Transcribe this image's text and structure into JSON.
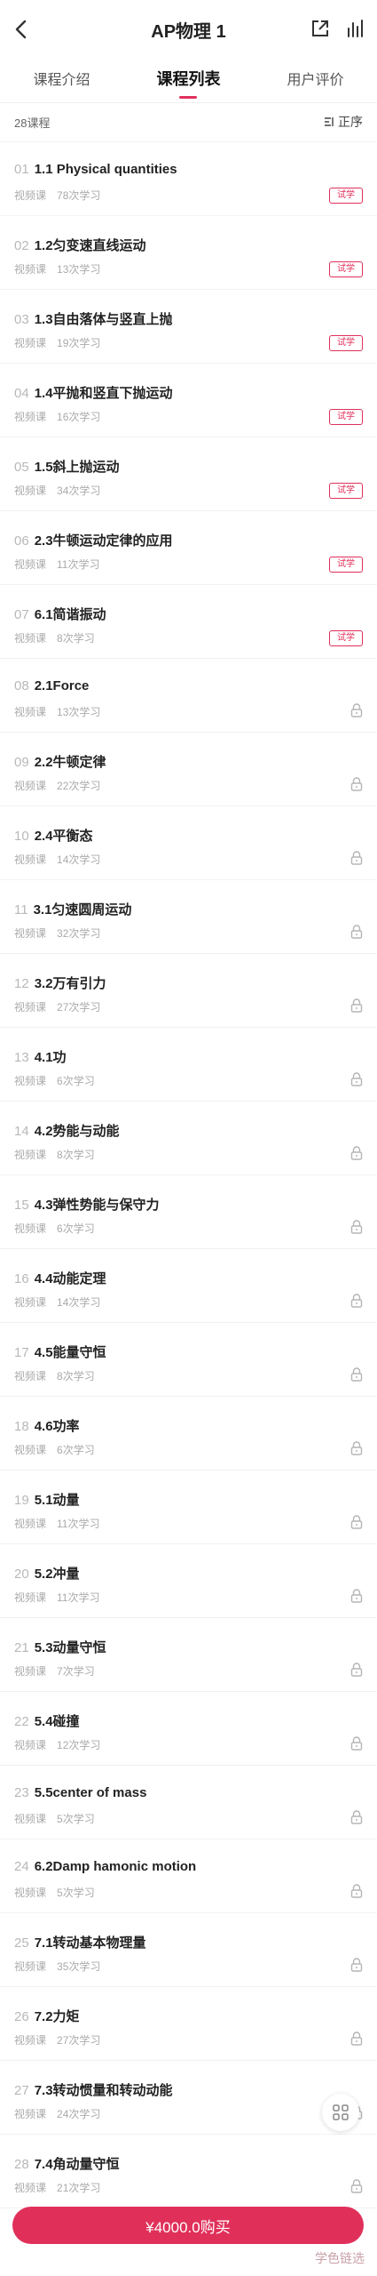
{
  "nav": {
    "title": "AP物理 1"
  },
  "tabs": [
    {
      "label": "课程介绍"
    },
    {
      "label": "课程列表"
    },
    {
      "label": "用户评价"
    }
  ],
  "list_head": {
    "count": "28课程",
    "sort": "正序"
  },
  "items": [
    {
      "num": "01",
      "title": "1.1 Physical quantities",
      "type": "视频课",
      "views": "78次学习",
      "badge": "试学"
    },
    {
      "num": "02",
      "title": "1.2匀变速直线运动",
      "type": "视频课",
      "views": "13次学习",
      "badge": "试学"
    },
    {
      "num": "03",
      "title": "1.3自由落体与竖直上抛",
      "type": "视频课",
      "views": "19次学习",
      "badge": "试学"
    },
    {
      "num": "04",
      "title": "1.4平抛和竖直下抛运动",
      "type": "视频课",
      "views": "16次学习",
      "badge": "试学"
    },
    {
      "num": "05",
      "title": "1.5斜上抛运动",
      "type": "视频课",
      "views": "34次学习",
      "badge": "试学"
    },
    {
      "num": "06",
      "title": "2.3牛顿运动定律的应用",
      "type": "视频课",
      "views": "11次学习",
      "badge": "试学"
    },
    {
      "num": "07",
      "title": "6.1简谐振动",
      "type": "视频课",
      "views": "8次学习",
      "badge": "试学"
    },
    {
      "num": "08",
      "title": "2.1Force",
      "type": "视频课",
      "views": "13次学习",
      "badge": ""
    },
    {
      "num": "09",
      "title": "2.2牛顿定律",
      "type": "视频课",
      "views": "22次学习",
      "badge": ""
    },
    {
      "num": "10",
      "title": "2.4平衡态",
      "type": "视频课",
      "views": "14次学习",
      "badge": ""
    },
    {
      "num": "11",
      "title": "3.1匀速圆周运动",
      "type": "视频课",
      "views": "32次学习",
      "badge": ""
    },
    {
      "num": "12",
      "title": "3.2万有引力",
      "type": "视频课",
      "views": "27次学习",
      "badge": ""
    },
    {
      "num": "13",
      "title": "4.1功",
      "type": "视频课",
      "views": "6次学习",
      "badge": ""
    },
    {
      "num": "14",
      "title": "4.2势能与动能",
      "type": "视频课",
      "views": "8次学习",
      "badge": ""
    },
    {
      "num": "15",
      "title": "4.3弹性势能与保守力",
      "type": "视频课",
      "views": "6次学习",
      "badge": ""
    },
    {
      "num": "16",
      "title": "4.4动能定理",
      "type": "视频课",
      "views": "14次学习",
      "badge": ""
    },
    {
      "num": "17",
      "title": "4.5能量守恒",
      "type": "视频课",
      "views": "8次学习",
      "badge": ""
    },
    {
      "num": "18",
      "title": "4.6功率",
      "type": "视频课",
      "views": "6次学习",
      "badge": ""
    },
    {
      "num": "19",
      "title": "5.1动量",
      "type": "视频课",
      "views": "11次学习",
      "badge": ""
    },
    {
      "num": "20",
      "title": "5.2冲量",
      "type": "视频课",
      "views": "11次学习",
      "badge": ""
    },
    {
      "num": "21",
      "title": "5.3动量守恒",
      "type": "视频课",
      "views": "7次学习",
      "badge": ""
    },
    {
      "num": "22",
      "title": "5.4碰撞",
      "type": "视频课",
      "views": "12次学习",
      "badge": ""
    },
    {
      "num": "23",
      "title": "5.5center of mass",
      "type": "视频课",
      "views": "5次学习",
      "badge": ""
    },
    {
      "num": "24",
      "title": "6.2Damp hamonic motion",
      "type": "视频课",
      "views": "5次学习",
      "badge": ""
    },
    {
      "num": "25",
      "title": "7.1转动基本物理量",
      "type": "视频课",
      "views": "35次学习",
      "badge": ""
    },
    {
      "num": "26",
      "title": "7.2力矩",
      "type": "视频课",
      "views": "27次学习",
      "badge": ""
    },
    {
      "num": "27",
      "title": "7.3转动惯量和转动动能",
      "type": "视频课",
      "views": "24次学习",
      "badge": ""
    },
    {
      "num": "28",
      "title": "7.4角动量守恒",
      "type": "视频课",
      "views": "21次学习",
      "badge": ""
    }
  ],
  "buy_button": {
    "label": "¥4000.0购买"
  },
  "watermark": "学色链选",
  "colors": {
    "accent": "#e0305a"
  }
}
